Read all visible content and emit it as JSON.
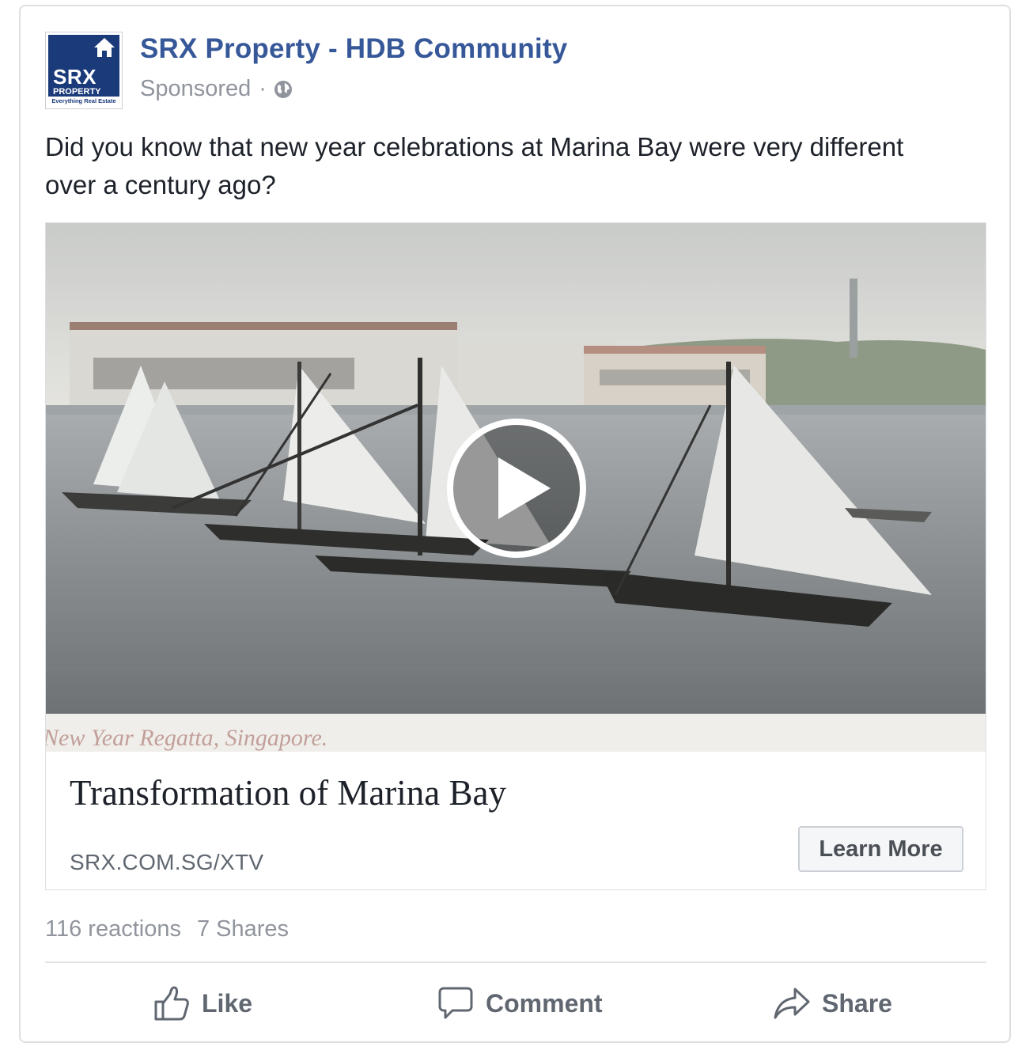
{
  "post": {
    "page_name": "SRX Property - HDB Community",
    "sponsored_label": "Sponsored",
    "meta_separator": "·",
    "audience_icon": "globe-icon",
    "text": "Did you know that new year celebrations at Marina Bay were very different over a century ago?"
  },
  "avatar": {
    "logo_text": "SRX",
    "logo_sub": "PROPERTY",
    "logo_tagline": "Everything Real Estate",
    "brand_color": "#1b3a7a"
  },
  "attachment": {
    "media_type": "video",
    "video_caption": "New Year Regatta, Singapore.",
    "play_icon": "play-icon",
    "title": "Transformation of Marina Bay",
    "domain": "SRX.COM.SG/XTV",
    "cta_label": "Learn More"
  },
  "stats": {
    "reactions": "116 reactions",
    "shares": "7 Shares"
  },
  "actions": {
    "like": "Like",
    "comment": "Comment",
    "share": "Share"
  },
  "colors": {
    "link_blue": "#365899",
    "muted": "#90949c",
    "border": "#dddfe2"
  }
}
